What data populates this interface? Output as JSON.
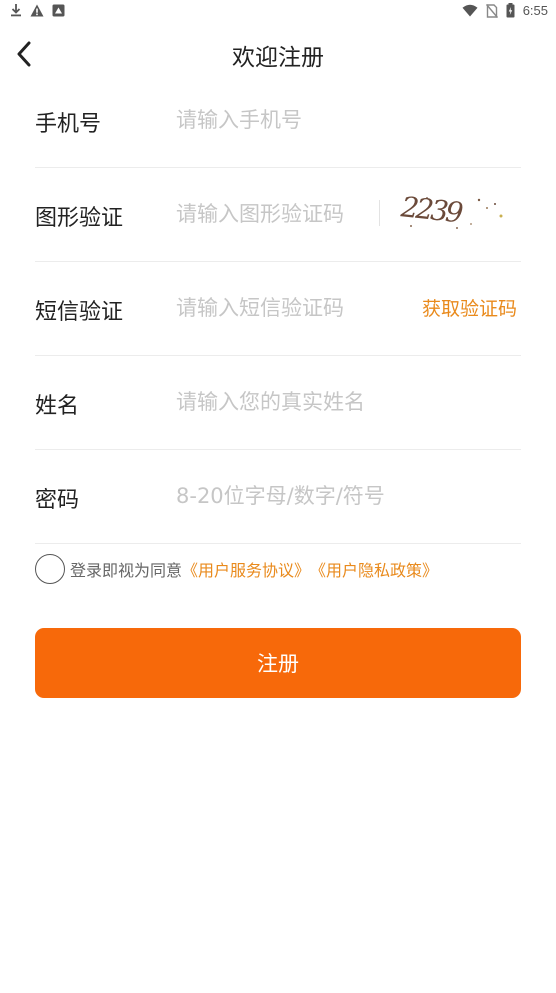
{
  "status_bar": {
    "time": "6:55",
    "left_icons": [
      "download-icon",
      "warning-icon",
      "image-icon"
    ],
    "right_icons": [
      "wifi-icon",
      "no-sim-icon",
      "battery-icon"
    ]
  },
  "header": {
    "title": "欢迎注册",
    "back_icon": "chevron-left-icon"
  },
  "form": {
    "phone": {
      "label": "手机号",
      "placeholder": "请输入手机号",
      "value": ""
    },
    "captcha": {
      "label": "图形验证",
      "placeholder": "请输入图形验证码",
      "value": "",
      "image_text": "2239"
    },
    "sms": {
      "label": "短信验证",
      "placeholder": "请输入短信验证码",
      "value": "",
      "get_code_label": "获取验证码"
    },
    "name": {
      "label": "姓名",
      "placeholder": "请输入您的真实姓名",
      "value": ""
    },
    "password": {
      "label": "密码",
      "placeholder": "8-20位字母/数字/符号",
      "value": ""
    }
  },
  "agreement": {
    "checked": false,
    "prefix": "登录即视为同意",
    "service_link": "《用户服务协议》",
    "privacy_link": "《用户隐私政策》"
  },
  "submit": {
    "label": "注册"
  },
  "colors": {
    "accent": "#f7690a",
    "link": "#e98a1c",
    "placeholder": "#c6c6c6"
  }
}
